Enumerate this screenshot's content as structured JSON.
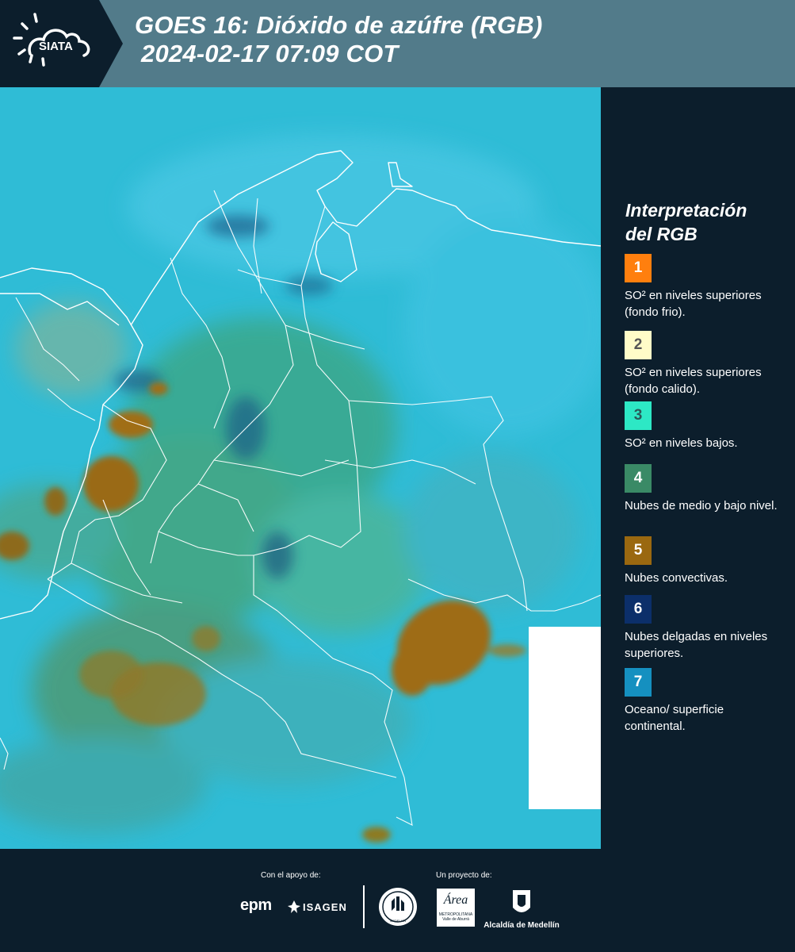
{
  "header": {
    "logo_text": "SIATA",
    "title_line1": "GOES 16: Dióxido de azúfre (RGB)",
    "title_line2": "2024-02-17 07:09 COT"
  },
  "legend": {
    "title_line1": "Interpretación",
    "title_line2": "del RGB",
    "items": [
      {
        "number": "1",
        "label": "SO² en niveles superiores (fondo frio).",
        "color": "#ff7f0e",
        "text_color": "#ffffff"
      },
      {
        "number": "2",
        "label": "SO² en niveles superiores (fondo calido).",
        "color": "#fffcc8",
        "text_color": "#555555"
      },
      {
        "number": "3",
        "label": "SO² en niveles bajos.",
        "color": "#2de8c5",
        "text_color": "#2a5a5a"
      },
      {
        "number": "4",
        "label": "Nubes de medio y bajo nivel.",
        "color": "#3a8a66",
        "text_color": "#ffffff"
      },
      {
        "number": "5",
        "label": "Nubes convectivas.",
        "color": "#9a6810",
        "text_color": "#ffffff"
      },
      {
        "number": "6",
        "label": "Nubes delgadas en niveles superiores.",
        "color": "#0c2f6a",
        "text_color": "#ffffff"
      },
      {
        "number": "7",
        "label": "Oceano/ superficie continental.",
        "color": "#1590c0",
        "text_color": "#ffffff"
      }
    ]
  },
  "footer": {
    "support_label": "Con el apoyo de:",
    "project_label": "Un proyecto de:",
    "epm_logo": "epm",
    "isagen_logo": "ISAGEN",
    "area_logo_big": "Área",
    "area_logo_small1": "METROPOLITANA",
    "area_logo_small2": "Valle de Aburrá",
    "alcaldia_label": "Alcaldía de Medellín",
    "seal_text": "MEDELLÍN"
  },
  "map": {
    "background_color": "#2fbcd6",
    "cloud_colors": {
      "convective": "#9a6a14",
      "mid_low": "#3aa07a"
    }
  }
}
